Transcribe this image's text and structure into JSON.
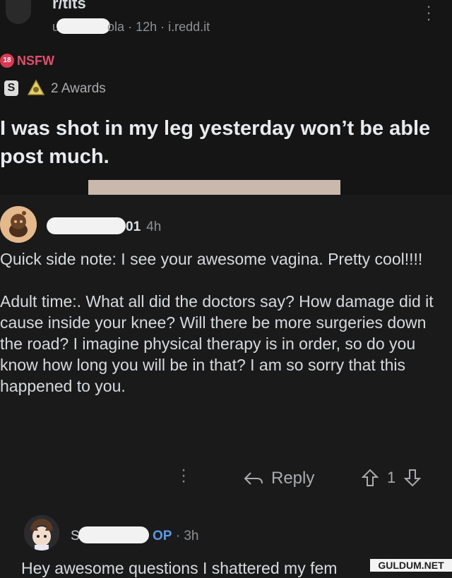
{
  "post": {
    "subreddit": "r/tits",
    "username_prefix": "u",
    "username_suffix": "ola",
    "age": "12h",
    "domain": "i.redd.it",
    "meta_sep": "·",
    "nsfw_label": "NSFW",
    "nsfw_badge": "18",
    "awards_label": "2 Awards",
    "title": "I was shot in my leg yesterday won’t be able post much."
  },
  "comment": {
    "username_suffix": "01",
    "age": "4h",
    "paragraphs": [
      "Quick side note: I see your awesome vagina.  Pretty cool!!!!",
      "Adult time:. What all did the doctors say?  How damage did it cause inside your knee?  Will there be more surgeries down the road?  I imagine physical therapy is in order, so do you know how long you will be in that?  I am so sorry that this happened to you."
    ],
    "reply_label": "Reply",
    "vote_count": "1"
  },
  "reply": {
    "username_prefix": "S",
    "op_label": "OP",
    "age": "3h",
    "body": "Hey awesome questions I shattered my fem"
  },
  "watermark": "GULDUM.NET",
  "colors": {
    "nsfw": "#d93a52",
    "op": "#5a9ae6",
    "background": "#1a1a1b"
  },
  "icons": {
    "more": "more-vertical-icon",
    "award_silver": "silver-award-icon",
    "award_helpful": "helpful-award-icon",
    "reply": "reply-arrow-icon",
    "upvote": "upvote-icon",
    "downvote": "downvote-icon"
  }
}
